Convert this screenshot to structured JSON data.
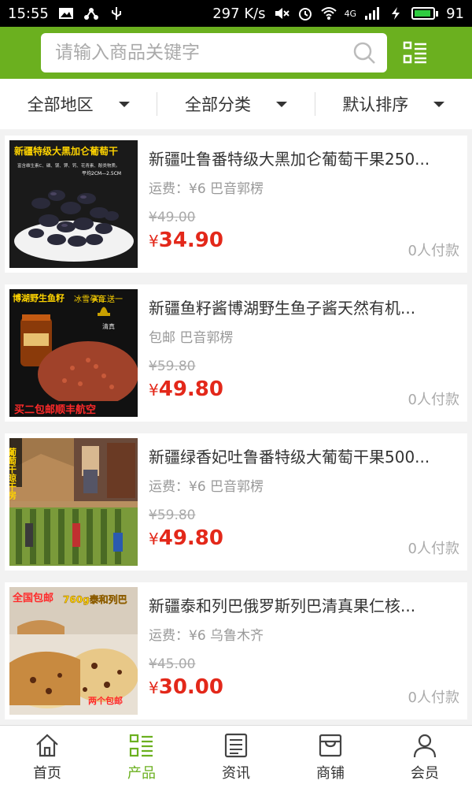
{
  "status_bar": {
    "time": "15:55",
    "net_speed": "297 K/s",
    "signal_label": "4G",
    "battery": "91",
    "battery_level": 0.91
  },
  "search": {
    "placeholder": "请输入商品关键字"
  },
  "filters": [
    {
      "label": "全部地区"
    },
    {
      "label": "全部分类"
    },
    {
      "label": "默认排序"
    }
  ],
  "products": [
    {
      "title": "新疆吐鲁番特级大黑加仑葡萄干果250...",
      "shipping": "运费：¥6 巴音郭楞",
      "old_price": "¥49.00",
      "currency": "¥",
      "price": "34.90",
      "paid": "0人付款",
      "image_text": [
        "新疆特级大黑加仑葡萄干",
        "富含维生素C、磷、镁、钾、钙、花青素、酚类物质。",
        "平均2CM—2.5CM"
      ]
    },
    {
      "title": "新疆鱼籽酱博湖野生鱼子酱天然有机...",
      "shipping": "包邮 巴音郭楞",
      "old_price": "¥59.80",
      "currency": "¥",
      "price": "49.80",
      "paid": "0人付款",
      "image_text": [
        "博湖野生鱼籽",
        "冰雪孕育",
        "买三送一",
        "清真",
        "买二包邮顺丰航空"
      ]
    },
    {
      "title": "新疆绿香妃吐鲁番特级大葡萄干果500...",
      "shipping": "运费：¥6 巴音郭楞",
      "old_price": "¥59.80",
      "currency": "¥",
      "price": "49.80",
      "paid": "0人付款",
      "image_text": [
        "葡萄干晾干房"
      ]
    },
    {
      "title": "新疆泰和列巴俄罗斯列巴清真果仁核...",
      "shipping": "运费：¥6 乌鲁木齐",
      "old_price": "¥45.00",
      "currency": "¥",
      "price": "30.00",
      "paid": "0人付款",
      "image_text": [
        "全国包邮",
        "760g泰和列巴",
        "两个包邮"
      ]
    }
  ],
  "bottom_nav": [
    {
      "label": "首页",
      "icon": "home-icon"
    },
    {
      "label": "产品",
      "icon": "product-list-icon",
      "active": true
    },
    {
      "label": "资讯",
      "icon": "news-icon"
    },
    {
      "label": "商铺",
      "icon": "store-icon"
    },
    {
      "label": "会员",
      "icon": "user-icon"
    }
  ],
  "colors": {
    "brand_green": "#6bb01f",
    "price_red": "#e3281a"
  }
}
